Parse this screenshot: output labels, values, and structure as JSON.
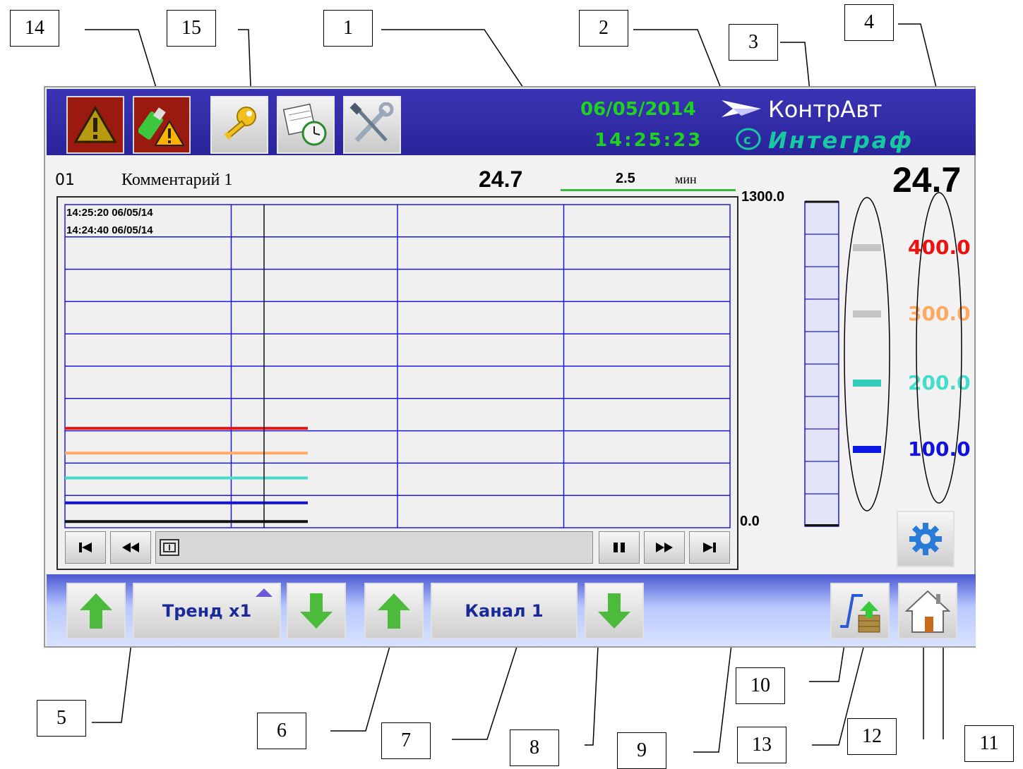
{
  "callouts": [
    "14",
    "15",
    "1",
    "2",
    "3",
    "4",
    "5",
    "6",
    "7",
    "8",
    "9",
    "10",
    "13",
    "12",
    "11"
  ],
  "topbar": {
    "date": "06/05/2014",
    "time": "14:25:23",
    "brand": "КонтрАвт",
    "brand_sub": "Интеграф",
    "buttons": [
      "alarm-icon",
      "usb-alarm-icon",
      "key-icon",
      "schedule-icon",
      "tools-icon"
    ]
  },
  "channel_header": {
    "number": "01",
    "comment": "Комментарий 1",
    "value": "24.7",
    "period_value": "2.5",
    "period_unit": "мин"
  },
  "trend": {
    "timestamp_top": "14:25:20  06/05/14",
    "timestamp_bottom": "14:24:40  06/05/14",
    "scale_max": "1300.0",
    "scale_min": "0.0",
    "lines": [
      {
        "color": "#ee1111",
        "value": 400.0
      },
      {
        "color": "#ffaa66",
        "value": 300.0
      },
      {
        "color": "#44ddcc",
        "value": 200.0
      },
      {
        "color": "#1111dd",
        "value": 100.0
      },
      {
        "color": "#111111",
        "value": 24.7
      }
    ]
  },
  "bar": {
    "value": 24.7,
    "min": 0,
    "max": 1300
  },
  "big_value": "24.7",
  "setpoints": [
    {
      "value": "400.0",
      "color": "#ee1111",
      "marker": "#c4c4c4"
    },
    {
      "value": "300.0",
      "color": "#ffa860",
      "marker": "#c4c4c4"
    },
    {
      "value": "200.0",
      "color": "#44ddcc",
      "marker": "#33ccbb"
    },
    {
      "value": "100.0",
      "color": "#1111dd",
      "marker": "#0a18e6"
    }
  ],
  "bottombar": {
    "mode_label": "Тренд x1",
    "channel_label": "Канал 1"
  },
  "colors": {
    "topbar": "#2e28a4",
    "grid": "#1a1add",
    "cursor": "#111111"
  }
}
